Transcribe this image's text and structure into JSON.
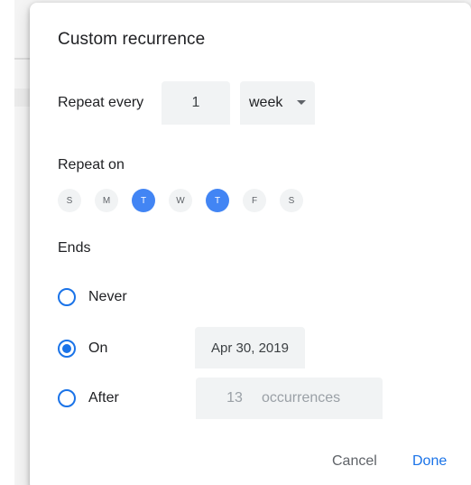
{
  "dialog": {
    "title": "Custom recurrence",
    "repeat_every_label": "Repeat every",
    "interval_value": "1",
    "unit_value": "week",
    "repeat_on_label": "Repeat on",
    "days": [
      {
        "label": "S",
        "selected": false
      },
      {
        "label": "M",
        "selected": false
      },
      {
        "label": "T",
        "selected": true
      },
      {
        "label": "W",
        "selected": false
      },
      {
        "label": "T",
        "selected": true
      },
      {
        "label": "F",
        "selected": false
      },
      {
        "label": "S",
        "selected": false
      }
    ],
    "ends_label": "Ends",
    "ends_options": {
      "never": {
        "label": "Never",
        "checked": false
      },
      "on": {
        "label": "On",
        "checked": true,
        "date": "Apr 30, 2019"
      },
      "after": {
        "label": "After",
        "checked": false,
        "count": "13",
        "unit": "occurrences"
      }
    },
    "cancel_label": "Cancel",
    "done_label": "Done"
  },
  "colors": {
    "accent": "#1a73e8",
    "day_selected": "#4285f4",
    "field_background": "#f1f3f4"
  }
}
